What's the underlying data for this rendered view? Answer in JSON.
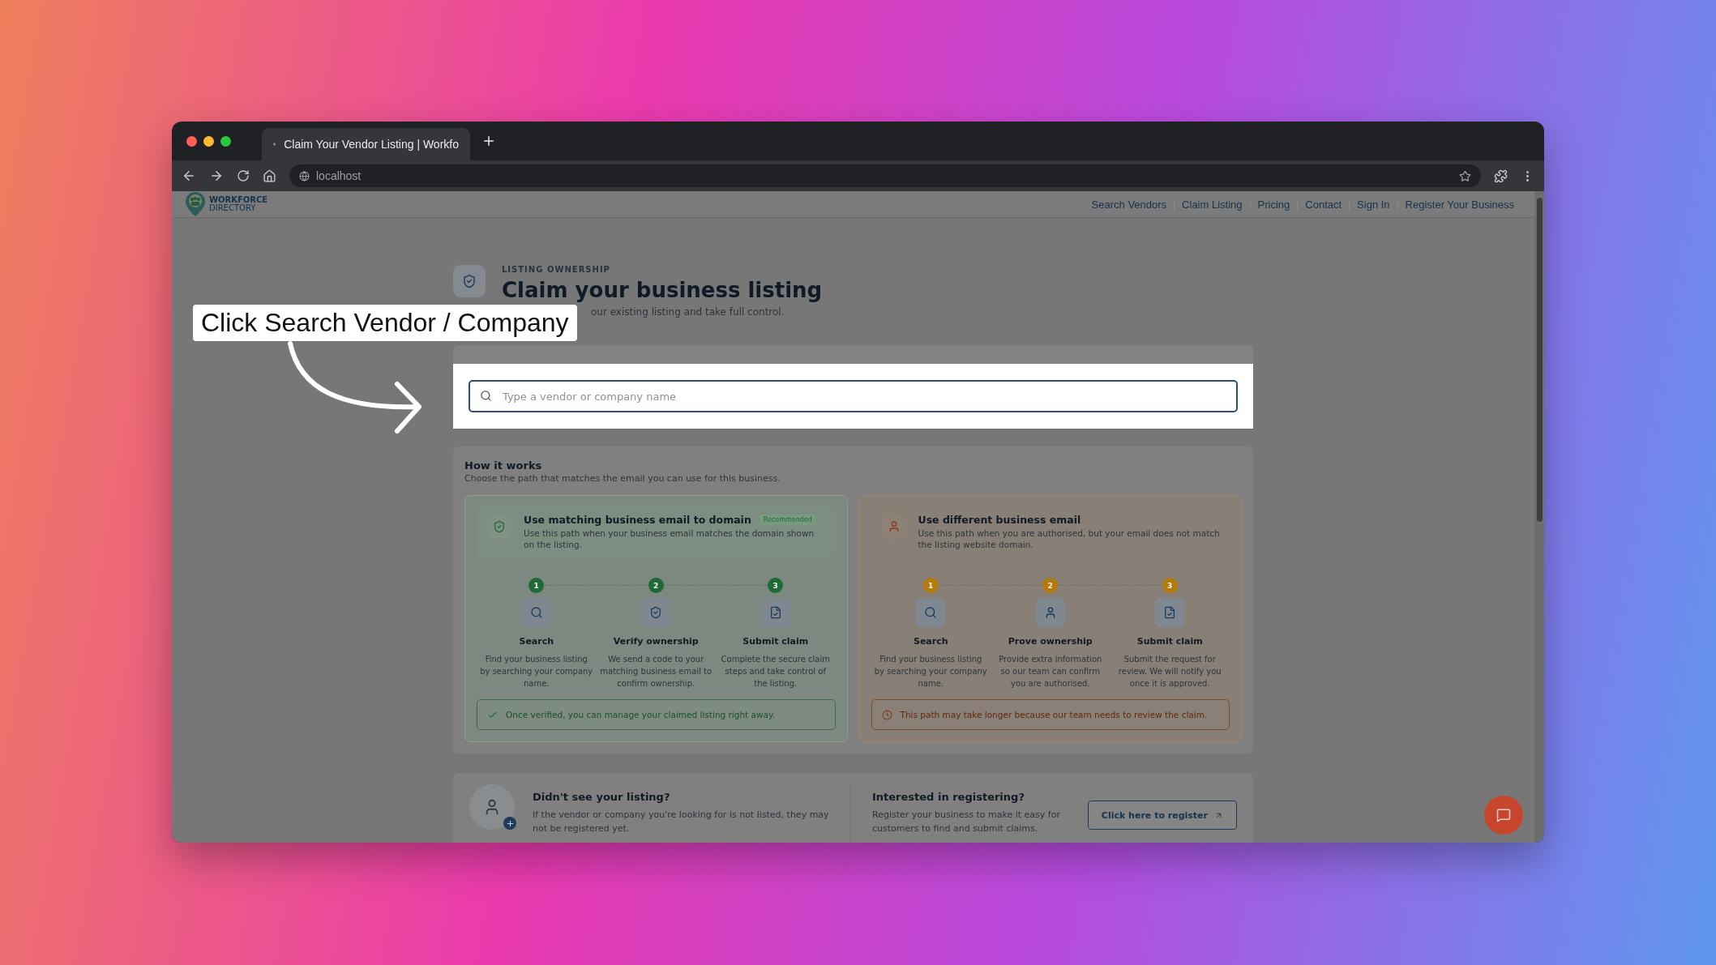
{
  "browser": {
    "tab_title": "Claim Your Vendor Listing | Workfo",
    "url": "localhost"
  },
  "nav": {
    "logo_top": "WORKFORCE",
    "logo_bottom": "DIRECTORY",
    "links": [
      "Search Vendors",
      "Claim Listing",
      "Pricing",
      "Contact",
      "Sign In",
      "Register Your Business"
    ]
  },
  "header": {
    "eyebrow": "LISTING OWNERSHIP",
    "title": "Claim your business listing",
    "subtitle": "our existing listing and take full control."
  },
  "search": {
    "placeholder": "Type a vendor or company name"
  },
  "callout": {
    "text": "Click Search Vendor / Company"
  },
  "how_it_works": {
    "title": "How it works",
    "subtitle": "Choose the path that matches the email you can use for this business.",
    "paths": [
      {
        "kind": "verified",
        "color": "#1e6b35",
        "title": "Use matching business email to domain",
        "badge": "Recommended",
        "description": "Use this path when your business email matches the domain shown on the listing.",
        "steps": [
          {
            "number": "1",
            "label": "Search",
            "description": "Find your business listing by searching your company name."
          },
          {
            "number": "2",
            "label": "Verify ownership",
            "description": "We send a code to your matching business email to confirm ownership."
          },
          {
            "number": "3",
            "label": "Submit claim",
            "description": "Complete the secure claim steps and take control of the listing."
          }
        ],
        "note": "Once verified, you can manage your claimed listing right away."
      },
      {
        "kind": "review",
        "color": "#b57a0b",
        "title": "Use different business email",
        "description": "Use this path when you are authorised, but your email does not match the listing website domain.",
        "steps": [
          {
            "number": "1",
            "label": "Search",
            "description": "Find your business listing by searching your company name."
          },
          {
            "number": "2",
            "label": "Prove ownership",
            "description": "Provide extra information so our team can confirm you are authorised."
          },
          {
            "number": "3",
            "label": "Submit claim",
            "description": "Submit the request for review. We will notify you once it is approved."
          }
        ],
        "note": "This path may take longer because our team needs to review the claim."
      }
    ]
  },
  "footer_card": {
    "missing_title": "Didn't see your listing?",
    "missing_text": "If the vendor or company you're looking for is not listed, they may not be registered yet.",
    "register_title": "Interested in registering?",
    "register_text": "Register your business to make it easy for customers to find and submit claims.",
    "register_button": "Click here to register"
  }
}
